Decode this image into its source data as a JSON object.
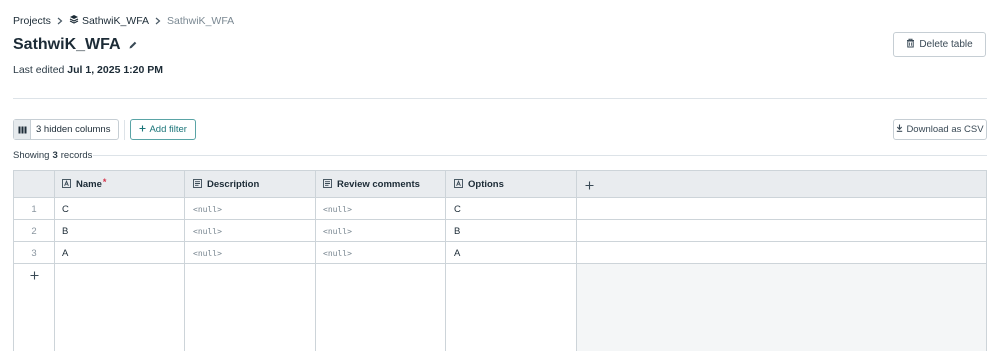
{
  "breadcrumb": {
    "root": "Projects",
    "database": "SathwiK_WFA",
    "current": "SathwiK_WFA"
  },
  "header": {
    "title": "SathwiK_WFA",
    "last_edited_label": "Last edited",
    "last_edited_value": "Jul 1, 2025 1:20 PM",
    "delete_label": "Delete table"
  },
  "toolbar": {
    "hidden_columns_label": "3 hidden columns",
    "add_filter_label": "Add filter",
    "download_label": "Download as CSV"
  },
  "records": {
    "prefix": "Showing",
    "count": "3",
    "suffix": "records"
  },
  "table": {
    "columns": [
      {
        "label": "Name",
        "type_icon": "text-type-icon",
        "required": true
      },
      {
        "label": "Description",
        "type_icon": "long-text-type-icon",
        "required": false
      },
      {
        "label": "Review comments",
        "type_icon": "long-text-type-icon",
        "required": false
      },
      {
        "label": "Options",
        "type_icon": "text-type-icon",
        "required": false
      }
    ],
    "rows": [
      {
        "num": "1",
        "name": "C",
        "description": "<null>",
        "review": "<null>",
        "options": "C"
      },
      {
        "num": "2",
        "name": "B",
        "description": "<null>",
        "review": "<null>",
        "options": "B"
      },
      {
        "num": "3",
        "name": "A",
        "description": "<null>",
        "review": "<null>",
        "options": "A"
      }
    ],
    "required_marker": "*",
    "add_symbol": "+"
  },
  "colors": {
    "accent": "#1a7478",
    "required": "#d6334a",
    "header_bg": "#e9ecef",
    "border": "#cdd4d9"
  }
}
